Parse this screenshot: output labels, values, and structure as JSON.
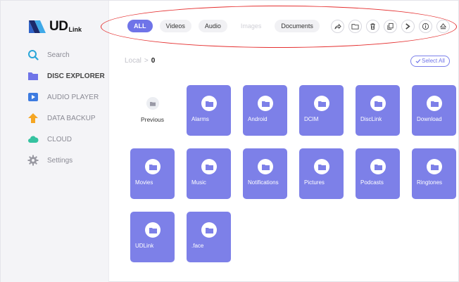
{
  "brand": {
    "name": "UD",
    "sub": "Link",
    "colors": {
      "primary": "#6f74e8",
      "tile": "#7d80e8",
      "annotation": "#e53030"
    }
  },
  "sidebar": {
    "items": [
      {
        "label": "Search",
        "icon": "search-icon",
        "active": false
      },
      {
        "label": "DISC EXPLORER",
        "icon": "folder-icon",
        "active": true
      },
      {
        "label": "AUDIO PLAYER",
        "icon": "play-icon",
        "active": false
      },
      {
        "label": "DATA BACKUP",
        "icon": "backup-arrow-icon",
        "active": false
      },
      {
        "label": "CLOUD",
        "icon": "cloud-icon",
        "active": false
      },
      {
        "label": "Settings",
        "icon": "gear-icon",
        "active": false
      }
    ]
  },
  "toolbar": {
    "filters": [
      {
        "label": "ALL",
        "state": "active"
      },
      {
        "label": "Videos",
        "state": "normal"
      },
      {
        "label": "Audio",
        "state": "normal"
      },
      {
        "label": "Images",
        "state": "disabled"
      },
      {
        "label": "Documents",
        "state": "normal"
      }
    ],
    "tools": [
      "share-icon",
      "folder-outline-icon",
      "trash-icon",
      "copy-icon",
      "move-icon",
      "info-icon",
      "eject-icon"
    ]
  },
  "breadcrumb": {
    "root": "Local",
    "separator": ">",
    "current": "0"
  },
  "select_all_label": "Select All",
  "grid": {
    "previous_label": "Previous",
    "folders": [
      "Alarms",
      "Android",
      "DCIM",
      "DiscLink",
      "Download",
      "Movies",
      "Music",
      "Notifications",
      "Pictures",
      "Podcasts",
      "Ringtones",
      "UDLink",
      ".face"
    ]
  }
}
